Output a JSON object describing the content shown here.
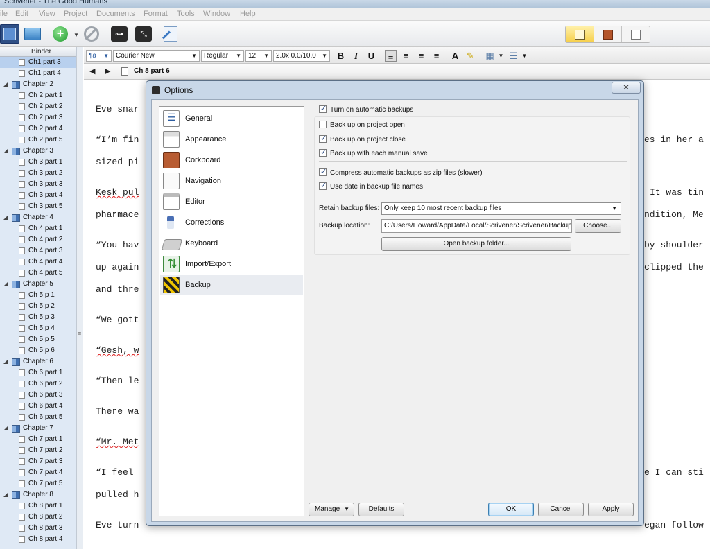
{
  "window": {
    "title": "Scrivener - The Good Humans"
  },
  "menubar": [
    "ile",
    "Edit",
    "View",
    "Project",
    "Documents",
    "Format",
    "Tools",
    "Window",
    "Help"
  ],
  "toolbar": {
    "composite_icon": "composite-view-icon",
    "folder_icon": "folder-icon",
    "add_icon": "add-icon",
    "add_symbol": "+",
    "dropdown_symbol": "▼",
    "delete_icon": "no-entry-icon",
    "key_icon": "keywords-icon",
    "key_symbol": "⊶",
    "full_icon": "full-screen-icon",
    "full_symbol": "⤡",
    "inspector_icon": "inspector-icon",
    "view_modes": [
      "scrivenings",
      "corkboard",
      "outliner"
    ],
    "active_view": "scrivenings",
    "accent_color": "#f6cf4a"
  },
  "binder": {
    "header": "Binder",
    "items": [
      {
        "type": "doc",
        "label": "Ch1 part 3",
        "selected": true
      },
      {
        "type": "doc",
        "label": "Ch1 part 4"
      },
      {
        "type": "folder",
        "label": "Chapter 2"
      },
      {
        "type": "doc",
        "label": "Ch 2 part 1"
      },
      {
        "type": "doc",
        "label": "Ch 2 part 2"
      },
      {
        "type": "doc",
        "label": "Ch 2 part 3"
      },
      {
        "type": "doc",
        "label": "Ch 2 part 4"
      },
      {
        "type": "doc",
        "label": "Ch 2 part 5"
      },
      {
        "type": "folder",
        "label": "Chapter 3"
      },
      {
        "type": "doc",
        "label": "Ch 3 part 1"
      },
      {
        "type": "doc",
        "label": "Ch 3 part 2"
      },
      {
        "type": "doc",
        "label": "Ch 3 part 3"
      },
      {
        "type": "doc",
        "label": "Ch 3 part 4"
      },
      {
        "type": "doc",
        "label": "Ch 3 part 5"
      },
      {
        "type": "folder",
        "label": "Chapter 4"
      },
      {
        "type": "doc",
        "label": "Ch 4 part 1"
      },
      {
        "type": "doc",
        "label": "Ch 4 part 2"
      },
      {
        "type": "doc",
        "label": "Ch 4 part 3"
      },
      {
        "type": "doc",
        "label": "Ch 4 part 4"
      },
      {
        "type": "doc",
        "label": "Ch 4 part 5"
      },
      {
        "type": "folder",
        "label": "Chapter 5"
      },
      {
        "type": "doc",
        "label": "Ch 5 p 1"
      },
      {
        "type": "doc",
        "label": "Ch 5 p 2"
      },
      {
        "type": "doc",
        "label": "Ch 5 p 3"
      },
      {
        "type": "doc",
        "label": "Ch 5 p 4"
      },
      {
        "type": "doc",
        "label": "Ch 5 p 5"
      },
      {
        "type": "doc",
        "label": "Ch 5 p 6"
      },
      {
        "type": "folder",
        "label": "Chapter 6"
      },
      {
        "type": "doc",
        "label": "Ch 6 part 1"
      },
      {
        "type": "doc",
        "label": "Ch 6 part 2"
      },
      {
        "type": "doc",
        "label": "Ch 6 part 3"
      },
      {
        "type": "doc",
        "label": "Ch 6 part 4"
      },
      {
        "type": "doc",
        "label": "Ch 6 part 5"
      },
      {
        "type": "folder",
        "label": "Chapter 7"
      },
      {
        "type": "doc",
        "label": "Ch 7 part 1"
      },
      {
        "type": "doc",
        "label": "Ch 7 part 2"
      },
      {
        "type": "doc",
        "label": "Ch 7 part 3"
      },
      {
        "type": "doc",
        "label": "Ch 7 part 4"
      },
      {
        "type": "doc",
        "label": "Ch 7 part 5"
      },
      {
        "type": "folder",
        "label": "Chapter 8"
      },
      {
        "type": "doc",
        "label": "Ch 8 part 1"
      },
      {
        "type": "doc",
        "label": "Ch 8 part 2"
      },
      {
        "type": "doc",
        "label": "Ch 8 part 3"
      },
      {
        "type": "doc",
        "label": "Ch 8 part 4"
      }
    ]
  },
  "formatbar": {
    "style_icon": "paragraph-style-icon",
    "style_symbol": "¶a",
    "font": "Courier New",
    "weight": "Regular",
    "size": "12",
    "spacing": "2.0x 0.0/10.0",
    "bold": "B",
    "italic": "I",
    "underline": "U",
    "align_left_symbol": "≡",
    "align_center_symbol": "≡",
    "align_justify_symbol": "≡",
    "align_right_symbol": "≡",
    "text_color_symbol": "A",
    "highlight_symbol": "✎",
    "table_symbol": "▦",
    "list_symbol": "☰",
    "dropdown_symbol": "▼"
  },
  "editor": {
    "back_symbol": "◀",
    "forward_symbol": "▶",
    "doc_title": "Ch 8 part 6",
    "left_lines": [
      "Eve snar",
      "“I’m fin",
      "sized pi",
      "Kesk pul",
      "pharmace",
      "“You hav",
      "up again",
      "and thre",
      "“We gott",
      "“Gesh, w",
      "“Then le",
      "There wa",
      "“Mr. Met",
      "“I feel",
      "pulled h",
      "Eve turn"
    ],
    "right_lines": [
      "es in her a",
      "It was tin",
      "ndition, Me",
      "by shoulder",
      "clipped the",
      "e I can sti",
      "egan follow"
    ]
  },
  "dialog": {
    "title": "Options",
    "close_symbol": "✕",
    "categories": [
      {
        "label": "General",
        "icon": "general-icon"
      },
      {
        "label": "Appearance",
        "icon": "appearance-icon"
      },
      {
        "label": "Corkboard",
        "icon": "corkboard-icon"
      },
      {
        "label": "Navigation",
        "icon": "navigation-icon"
      },
      {
        "label": "Editor",
        "icon": "editor-icon"
      },
      {
        "label": "Corrections",
        "icon": "corrections-icon"
      },
      {
        "label": "Keyboard",
        "icon": "keyboard-icon"
      },
      {
        "label": "Import/Export",
        "icon": "import-export-icon"
      },
      {
        "label": "Backup",
        "icon": "backup-icon",
        "selected": true
      }
    ],
    "backup": {
      "turn_on": {
        "label": "Turn on automatic backups",
        "checked": true
      },
      "on_open": {
        "label": "Back up on project open",
        "checked": false
      },
      "on_close": {
        "label": "Back up on project close",
        "checked": true
      },
      "on_save": {
        "label": "Back up with each manual save",
        "checked": true
      },
      "compress": {
        "label": "Compress automatic backups as zip files (slower)",
        "checked": true
      },
      "use_date": {
        "label": "Use date in backup file names",
        "checked": true
      },
      "retain_label": "Retain backup files:",
      "retain_value": "Only keep 10 most recent backup files",
      "location_label": "Backup location:",
      "location_value": "C:/Users/Howard/AppData/Local/Scrivener/Scrivener/Backups",
      "choose_label": "Choose...",
      "open_folder_label": "Open backup folder..."
    },
    "footer": {
      "manage_label": "Manage",
      "defaults_label": "Defaults",
      "ok_label": "OK",
      "cancel_label": "Cancel",
      "apply_label": "Apply"
    }
  }
}
